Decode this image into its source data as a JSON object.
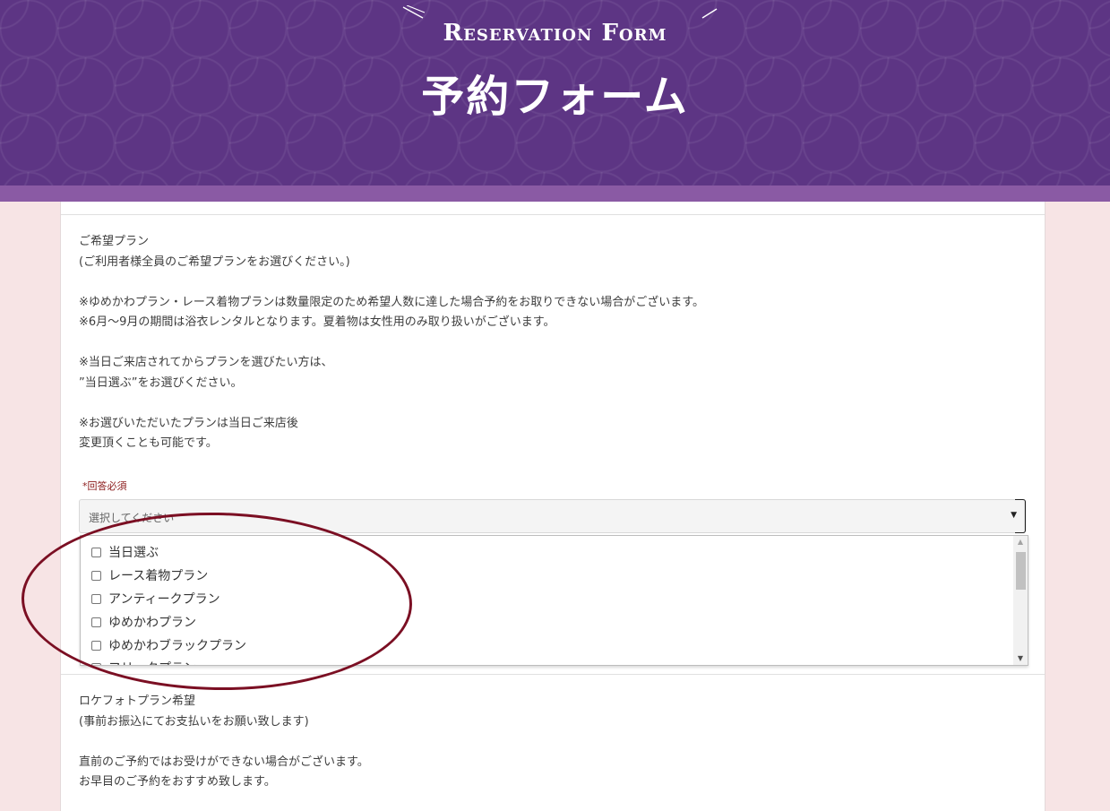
{
  "header": {
    "title_en": "Reservation Form",
    "title_jp": "予約フォーム"
  },
  "question1": {
    "lines": [
      "ご希望プラン",
      "(ご利用者様全員のご希望プランをお選びください。)",
      "",
      "※ゆめかわプラン・レース着物プランは数量限定のため希望人数に達した場合予約をお取りできない場合がございます。",
      "※6月～9月の期間は浴衣レンタルとなります。夏着物は女性用のみ取り扱いがございます。",
      "",
      "※当日ご来店されてからプランを選びたい方は、",
      "”当日選ぶ”をお選びください。",
      "",
      "※お選びいただいたプランは当日ご来店後",
      "変更頂くことも可能です。"
    ],
    "required_label": "*回答必須",
    "select_placeholder": "選択してください",
    "options": [
      "当日選ぶ",
      "レース着物プラン",
      "アンティークプラン",
      "ゆめかわプラン",
      "ゆめかわブラックプラン",
      "フリークプラン"
    ]
  },
  "question2": {
    "lines": [
      "ロケフォトプラン希望",
      "(事前お振込にてお支払いをお願い致します)",
      "",
      "直前のご予約ではお受けができない場合がございます。",
      "お早目のご予約をおすすめ致します。"
    ]
  },
  "colors": {
    "header_purple": "#5d3584",
    "band_purple": "#8a5aa4",
    "page_pink": "#f7e4e5",
    "annotation_red": "#7b0f23",
    "required_red": "#8b1a1a"
  }
}
